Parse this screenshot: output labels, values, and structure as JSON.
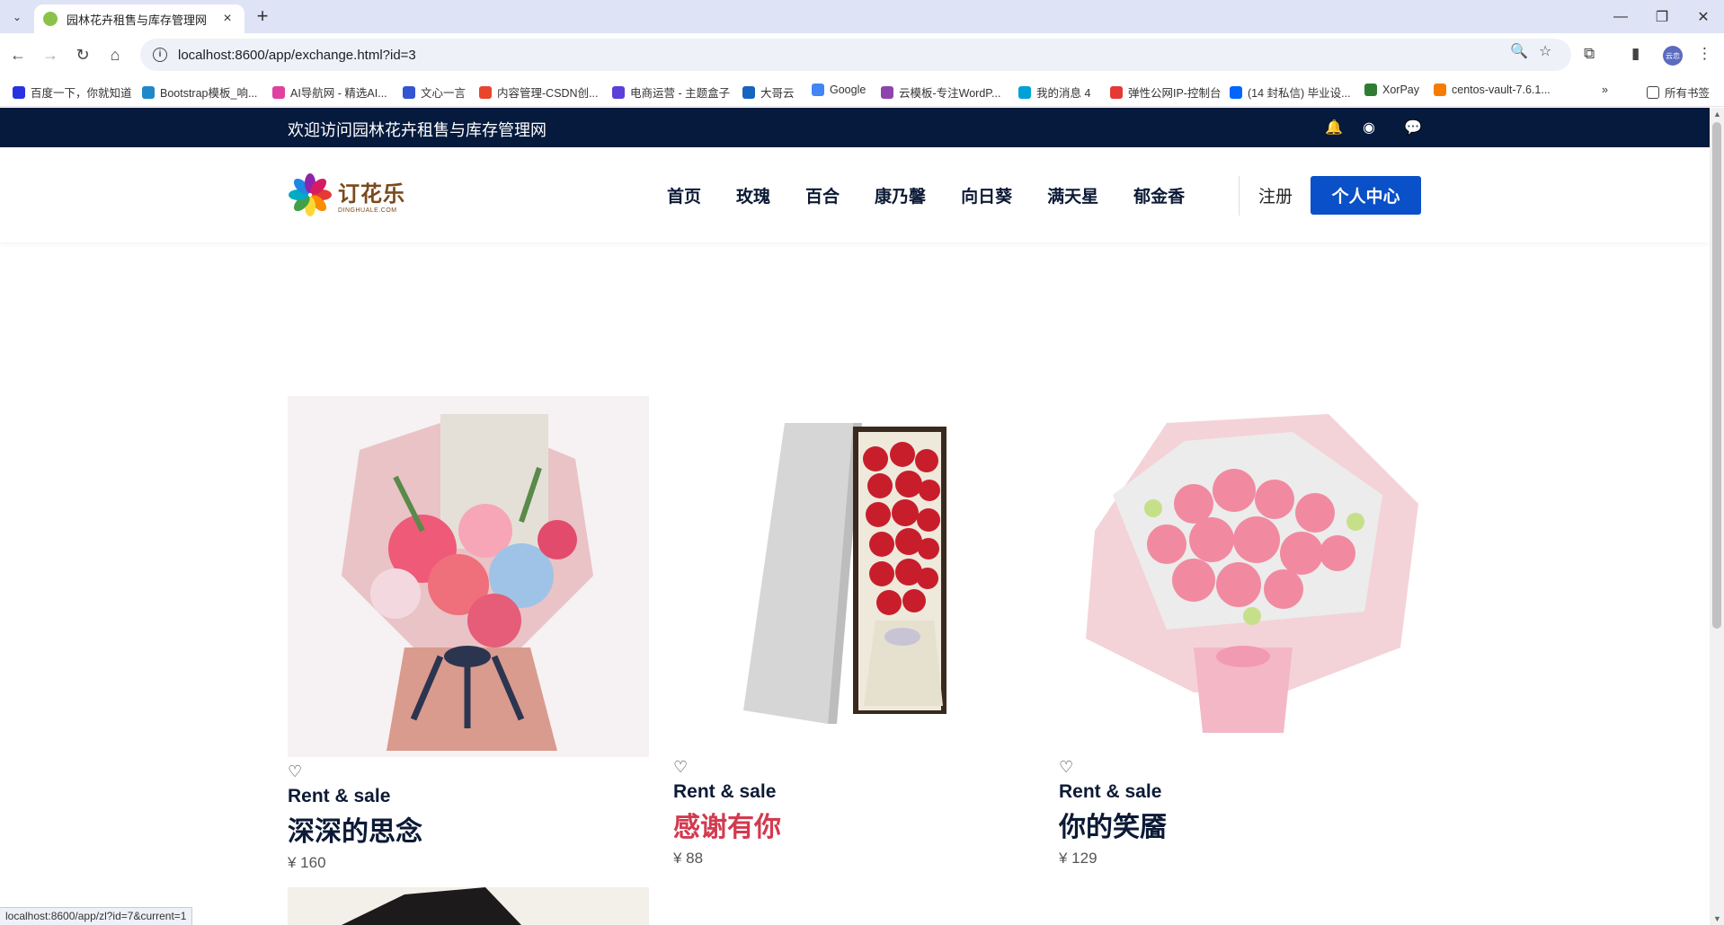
{
  "browser": {
    "tab_title": "园林花卉租售与库存管理网",
    "url": "localhost:8600/app/exchange.html?id=3",
    "status_url": "localhost:8600/app/zl?id=7&current=1",
    "profile_label": "云恋",
    "bookmarks": [
      {
        "label": "百度一下，你就知道",
        "color": "#2932e1"
      },
      {
        "label": "Bootstrap模板_响...",
        "color": "#1e88c8"
      },
      {
        "label": "AI导航网 - 精选AI...",
        "color": "#e040a0"
      },
      {
        "label": "文心一言",
        "color": "#3454d1"
      },
      {
        "label": "内容管理-CSDN创...",
        "color": "#e8452c"
      },
      {
        "label": "电商运营 - 主题盒子",
        "color": "#5b3fd8"
      },
      {
        "label": "大哥云",
        "color": "#1565c0"
      },
      {
        "label": "Google",
        "color": "#4285f4"
      },
      {
        "label": "云模板-专注WordP...",
        "color": "#8e44ad"
      },
      {
        "label": "我的消息 4",
        "color": "#00a1d6"
      },
      {
        "label": "弹性公网IP-控制台",
        "color": "#e53935"
      },
      {
        "label": "(14 封私信) 毕业设...",
        "color": "#0066ff"
      },
      {
        "label": "XorPay",
        "color": "#2e7d32"
      },
      {
        "label": "centos-vault-7.6.1...",
        "color": "#f57c00"
      }
    ],
    "all_bookmarks": "所有书签"
  },
  "site": {
    "welcome": "欢迎访问园林花卉租售与库存管理网",
    "logo_cn": "订花乐",
    "logo_en": "DINGHUALE.COM",
    "nav": [
      "首页",
      "玫瑰",
      "百合",
      "康乃馨",
      "向日葵",
      "满天星",
      "郁金香"
    ],
    "register": "注册",
    "user_center": "个人中心"
  },
  "products": [
    {
      "subtitle": "Rent & sale",
      "name": "深深的思念",
      "price": "¥ 160"
    },
    {
      "subtitle": "Rent & sale",
      "name": "感谢有你",
      "price": "¥ 88"
    },
    {
      "subtitle": "Rent & sale",
      "name": "你的笑靥",
      "price": "¥ 129"
    }
  ],
  "colors": {
    "topbar": "#051a3d",
    "accent": "#0a50c8",
    "hover_title": "#d33a4f"
  }
}
